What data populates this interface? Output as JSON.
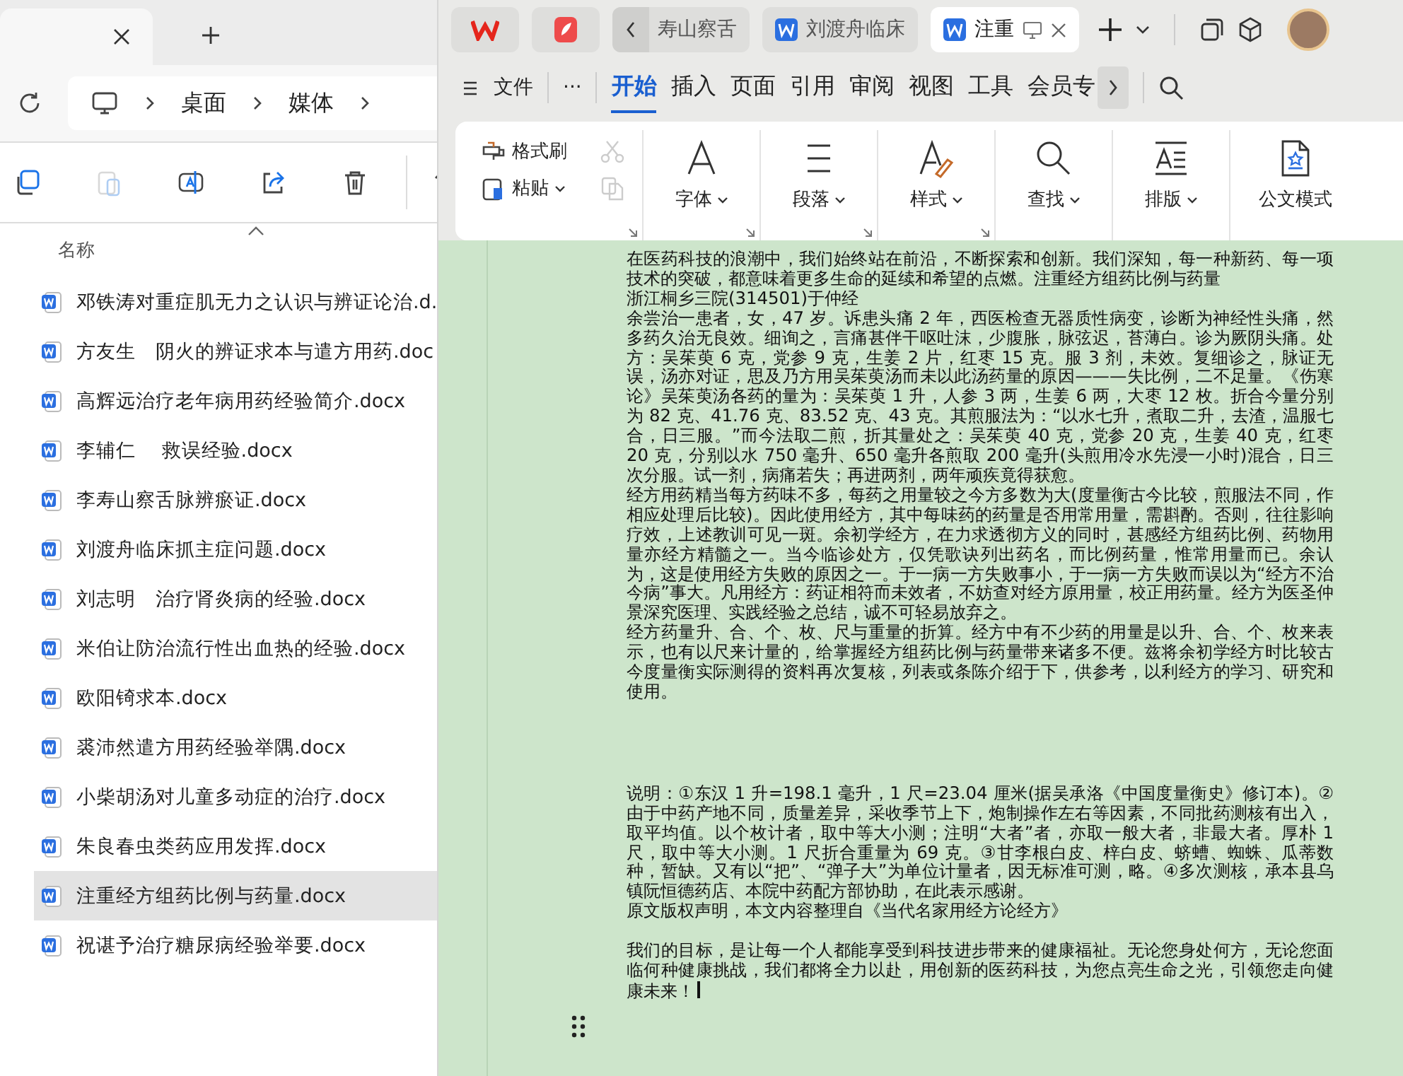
{
  "explorer": {
    "breadcrumb": [
      "桌面",
      "媒体"
    ],
    "toolbar": [
      {
        "kind": "copy",
        "disabled": false
      },
      {
        "kind": "paste",
        "disabled": true
      },
      {
        "kind": "rename",
        "disabled": false
      },
      {
        "kind": "share",
        "disabled": false
      },
      {
        "kind": "delete",
        "disabled": false
      },
      {
        "kind": "sort",
        "disabled": false
      }
    ],
    "column_header": "名称",
    "files": [
      {
        "name": "邓铁涛对重症肌无力之认识与辨证论治.d.",
        "selected": false
      },
      {
        "name": "方友生　阴火的辨证求本与遣方用药.doc",
        "selected": false
      },
      {
        "name": "高辉远治疗老年病用药经验简介.docx",
        "selected": false
      },
      {
        "name": "李辅仁　 救误经验.docx",
        "selected": false
      },
      {
        "name": "李寿山察舌脉辨瘀证.docx",
        "selected": false
      },
      {
        "name": "刘渡舟临床抓主症问题.docx",
        "selected": false
      },
      {
        "name": "刘志明　治疗肾炎病的经验.docx",
        "selected": false
      },
      {
        "name": "米伯让防治流行性出血热的经验.docx",
        "selected": false
      },
      {
        "name": "欧阳锜求本.docx",
        "selected": false
      },
      {
        "name": "裘沛然遣方用药经验举隅.docx",
        "selected": false
      },
      {
        "name": "小柴胡汤对儿童多动症的治疗.docx",
        "selected": false
      },
      {
        "name": "朱良春虫类药应用发挥.docx",
        "selected": false
      },
      {
        "name": "注重经方组药比例与药量.docx",
        "selected": true
      },
      {
        "name": "祝谌予治疗糖尿病经验举要.docx",
        "selected": false
      }
    ]
  },
  "wps": {
    "tabs": [
      {
        "label": "寿山察舌",
        "selected": false,
        "kind": "back"
      },
      {
        "label": "刘渡舟临床",
        "selected": false,
        "kind": "doc"
      },
      {
        "label": "注重",
        "selected": true,
        "kind": "doc"
      }
    ],
    "file_menu": "文件",
    "more": "···",
    "menu": [
      {
        "label": "开始",
        "selected": true
      },
      {
        "label": "插入",
        "selected": false
      },
      {
        "label": "页面",
        "selected": false
      },
      {
        "label": "引用",
        "selected": false
      },
      {
        "label": "审阅",
        "selected": false
      },
      {
        "label": "视图",
        "selected": false
      },
      {
        "label": "工具",
        "selected": false
      },
      {
        "label": "会员专",
        "selected": false
      }
    ],
    "clipboard": [
      {
        "label": "格式刷",
        "kind": "brush"
      },
      {
        "label": "粘贴",
        "kind": "paste"
      }
    ],
    "clipboard_small": [
      {
        "kind": "cut",
        "disabled": true
      },
      {
        "kind": "copy",
        "disabled": true
      }
    ],
    "ribbon": [
      {
        "label": "字体",
        "kind": "font",
        "launcher": true
      },
      {
        "label": "段落",
        "kind": "paragraph",
        "launcher": true
      },
      {
        "label": "样式",
        "kind": "style",
        "launcher": true
      },
      {
        "label": "查找",
        "kind": "find",
        "launcher": false
      },
      {
        "label": "排版",
        "kind": "layout",
        "launcher": false
      },
      {
        "label": "公文模式",
        "kind": "official",
        "launcher": false
      }
    ]
  },
  "document": {
    "blocks": [
      [
        "在医药科技的浪潮中，我们始终站在前沿，不断探索和创新。我们深知，每一种新药、每一项技术的突破，都意味着更多生命的延续和希望的点燃。注重经方组药比例与药量",
        "浙江桐乡三院(314501)于仲经",
        "余尝治一患者，女，47 岁。诉患头痛 2 年，西医检查无器质性病变，诊断为神经性头痛，然多药久治无良效。细询之，言痛甚伴干呕吐沫，少腹胀，脉弦迟，苔薄白。诊为厥阴头痛。处方：吴茱萸 6 克，党参 9 克，生姜 2 片，红枣 15 克。服 3 剂，未效。复细诊之，脉证无误，汤亦对证，思及乃方用吴茱萸汤而未以此汤药量的原因———失比例，二不足量。《伤寒论》吴茱萸汤各药的量为：吴茱萸 1 升，人参 3 两，生姜 6 两，大枣 12 枚。折合今量分别为 82 克、41.76 克、83.52 克、43 克。其煎服法为：“以水七升，煮取二升，去渣，温服七合，日三服。”而今法取二煎，折其量处之：吴茱萸 40 克，党参 20 克，生姜 40 克，红枣 20 克，分别以水 750 毫升、650 毫升各煎取 200 毫升(头煎用冷水先浸一小时)混合，日三次分服。试一剂，病痛若失；再进两剂，两年顽疾竟得获愈。",
        "经方用药精当每方药味不多，每药之用量较之今方多数为大(度量衡古今比较，煎服法不同，作相应处理后比较)。因此使用经方，其中每味药的药量是否用常用量，需斟酌。否则，往往影响疗效，上述教训可见一斑。余初学经方，在力求透彻方义的同时，甚感经方组药比例、药物用量亦经方精髓之一。当今临诊处方，仅凭歌诀列出药名，而比例药量，惟常用量而已。余认为，这是使用经方失败的原因之一。于一病一方失败事小，于一病一方失败而误以为“经方不治今病”事大。凡用经方：药证相符而未效者，不妨查对经方原用量，校正用药量。经方为医圣仲景深究医理、实践经验之总结，诚不可轻易放弃之。",
        "经方药量升、合、个、枚、尺与重量的折算。经方中有不少药的用量是以升、合、个、枚来表示，也有以尺来计量的，给掌握经方组药比例与药量带来诸多不便。兹将余初学经方时比较古今度量衡实际测得的资料再次复核，列表或条陈介绍于下，供参考，以利经方的学习、研究和使用。"
      ],
      [
        "说明：①东汉 1 升=198.1 毫升，1 尺=23.04 厘米(据吴承洛《中国度量衡史》修订本)。②由于中药产地不同，质量差异，采收季节上下，炮制操作左右等因素，不同批药测核有出入，取平均值。以个枚计者，取中等大小测；注明“大者”者，亦取一般大者，非最大者。厚朴 1 尺，取中等大小测。1 尺折合重量为 69 克。③甘李根白皮、梓白皮、蛴螬、蜘蛛、瓜蒂数种，暂缺。又有以“把”、“弹子大”为单位计量者，因无标准可测，略。④多次测核，承本县乌镇阮恒德药店、本院中药配方部协助，在此表示感谢。",
        "原文版权声明，本文内容整理自《当代名家用经方论经方》"
      ],
      [
        "我们的目标，是让每一个人都能享受到科技进步带来的健康福祉。无论您身处何方，无论您面临何种健康挑战，我们都将全力以赴，用创新的医药科技，为您点亮生命之光，引领您走向健康未来！"
      ]
    ]
  }
}
